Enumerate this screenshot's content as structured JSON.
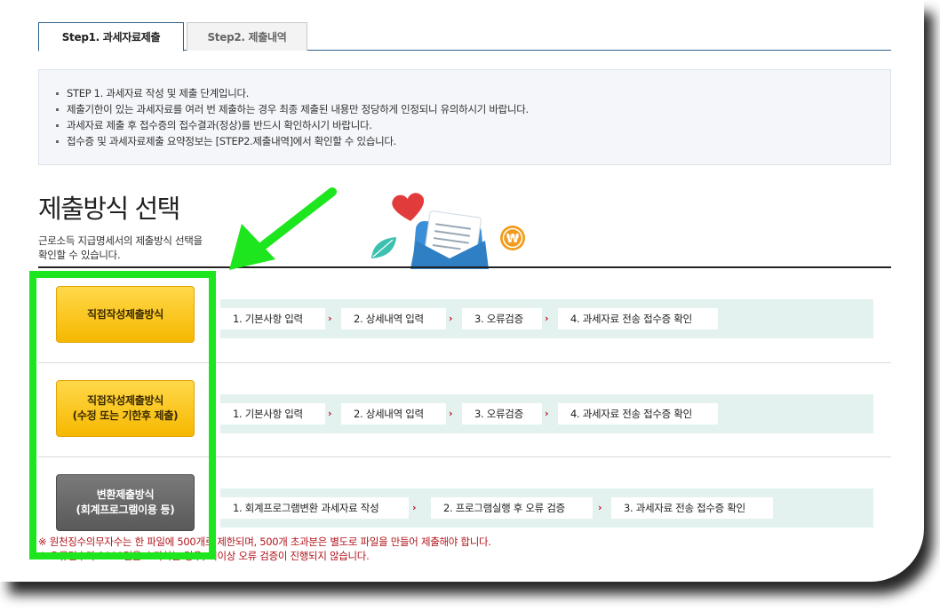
{
  "tabs": [
    {
      "label": "Step1. 과세자료제출",
      "active": true
    },
    {
      "label": "Step2. 제출내역",
      "active": false
    }
  ],
  "notice": {
    "items": [
      "STEP 1. 과세자료 작성 및 제출 단계입니다.",
      "제출기한이 있는 과세자료를 여러 번 제출하는 경우 최종 제출된 내용만 정당하게 인정되니 유의하시기 바랍니다.",
      "과세자료 제출 후 접수증의 접수결과(정상)를 반드시 확인하시기 바랍니다.",
      "접수증 및 과세자료제출 요약정보는 [STEP2.제출내역]에서 확인할 수 있습니다."
    ]
  },
  "section": {
    "title": "제출방식 선택",
    "desc_line1": "근로소득 지급명세서의 제출방식 선택을",
    "desc_line2": "확인할 수 있습니다."
  },
  "methods": [
    {
      "button_line1": "직접작성제출방식",
      "button_line2": "",
      "steps": [
        "1. 기본사항 입력",
        "2. 상세내역 입력",
        "3. 오류검증",
        "4. 과세자료 전송 접수증 확인"
      ]
    },
    {
      "button_line1": "직접작성제출방식",
      "button_line2": "(수정 또는 기한후 제출)",
      "steps": [
        "1. 기본사항 입력",
        "2. 상세내역 입력",
        "3. 오류검증",
        "4. 과세자료 전송 접수증 확인"
      ]
    },
    {
      "button_line1": "변환제출방식",
      "button_line2": "(회계프로그램이용 등)",
      "steps": [
        "1. 회계프로그램변환 과세자료 작성",
        "2. 프로그램실행 후 오류 검증",
        "3. 과세자료 전송 접수증 확인"
      ]
    }
  ],
  "arrow_glyph": "›",
  "footnotes": [
    "※ 원천징수의무자수는 한 파일에 500개로 제한되며, 500개 초과분은 별도로 파일을 만들어 제출해야 합니다.",
    "※ 오류건수가 1000건을 초과하는 경우, 더이상 오류 검증이 진행되지 않습니다."
  ],
  "colors": {
    "accent_blue": "#2e5f8a",
    "button_yellow": "#f6b800",
    "button_gray": "#595959",
    "flow_bg": "#e3f2ef",
    "arrow_red": "#c0112a",
    "footnote_red": "#b2151b",
    "highlight_green": "#1ee61e"
  },
  "icons": [
    "heart-icon",
    "leaf-icon",
    "mail-envelope-icon",
    "won-coin-icon"
  ]
}
